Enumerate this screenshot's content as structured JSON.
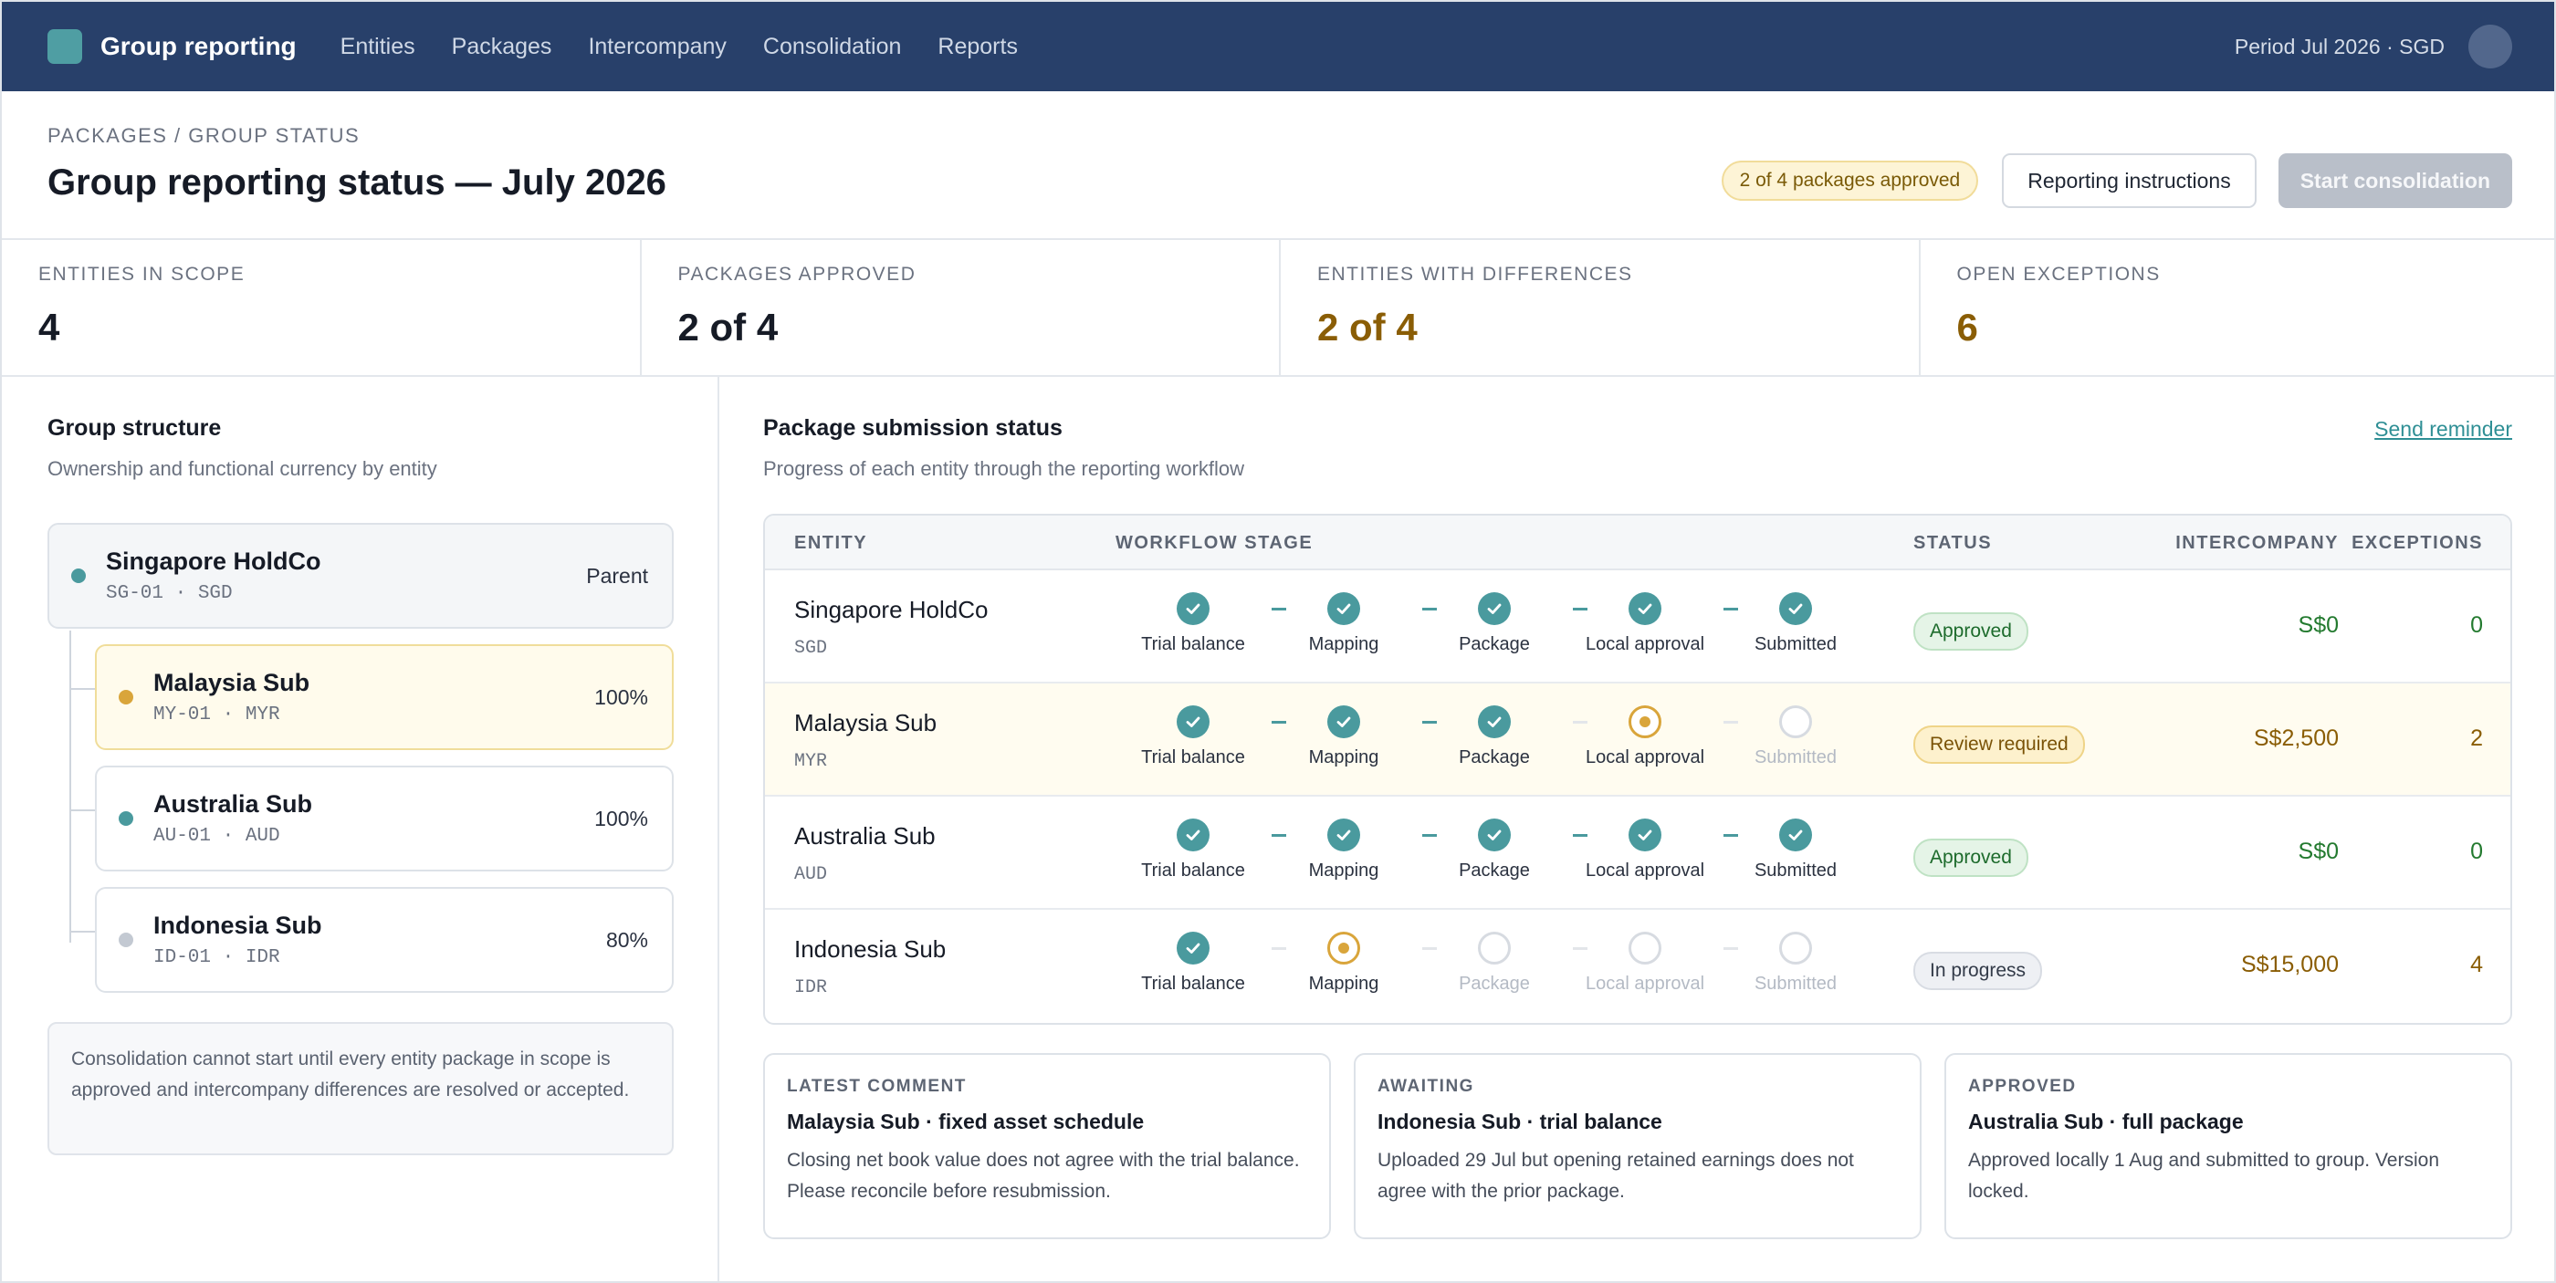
{
  "nav": {
    "brand": "Group reporting",
    "items": [
      "Entities",
      "Packages",
      "Intercompany",
      "Consolidation",
      "Reports"
    ],
    "period": "Period Jul 2026 · SGD"
  },
  "header": {
    "breadcrumb": "PACKAGES / GROUP STATUS",
    "title": "Group reporting status — July 2026",
    "approved_pill": "2 of 4 packages approved",
    "instructions_label": "Reporting instructions",
    "start_label": "Start consolidation"
  },
  "kpis": [
    {
      "label": "ENTITIES IN SCOPE",
      "value": "4"
    },
    {
      "label": "PACKAGES APPROVED",
      "value": "2 of 4"
    },
    {
      "label": "ENTITIES WITH DIFFERENCES",
      "value": "2 of 4"
    },
    {
      "label": "OPEN EXCEPTIONS",
      "value": "6"
    }
  ],
  "structure": {
    "title": "Group structure",
    "subtitle": "Ownership and functional currency by entity",
    "entities": [
      {
        "name": "Singapore HoldCo",
        "code": "SG-01 · SGD",
        "right": "Parent",
        "dot": "#4a9a9e"
      },
      {
        "name": "Malaysia Sub",
        "code": "MY-01 · MYR",
        "right": "100%",
        "dot": "#d9a53b"
      },
      {
        "name": "Australia Sub",
        "code": "AU-01 · AUD",
        "right": "100%",
        "dot": "#4a9a9e"
      },
      {
        "name": "Indonesia Sub",
        "code": "ID-01 · IDR",
        "right": "80%",
        "dot": "#c3c9d2"
      }
    ],
    "note": "Consolidation cannot start until every entity package in scope is approved and intercompany differences are resolved or accepted."
  },
  "submissions": {
    "title": "Package submission status",
    "subtitle": "Progress of each entity through the reporting workflow",
    "reminder": "Send reminder",
    "columns": [
      "ENTITY",
      "WORKFLOW STAGE",
      "STATUS",
      "INTERCOMPANY",
      "EXCEPTIONS"
    ],
    "stage_names": [
      "Trial balance",
      "Mapping",
      "Package",
      "Local approval",
      "Submitted"
    ],
    "rows": [
      {
        "name": "Singapore HoldCo",
        "currency": "SGD",
        "stages": [
          "done",
          "done",
          "done",
          "done",
          "done"
        ],
        "status": "Approved",
        "status_kind": "approved",
        "intercompany": "S$0",
        "exceptions": "0",
        "tone": "ok"
      },
      {
        "name": "Malaysia Sub",
        "currency": "MYR",
        "stages": [
          "done",
          "done",
          "done",
          "current",
          "pending"
        ],
        "status": "Review required",
        "status_kind": "review",
        "intercompany": "S$2,500",
        "exceptions": "2",
        "tone": "warn"
      },
      {
        "name": "Australia Sub",
        "currency": "AUD",
        "stages": [
          "done",
          "done",
          "done",
          "done",
          "done"
        ],
        "status": "Approved",
        "status_kind": "approved",
        "intercompany": "S$0",
        "exceptions": "0",
        "tone": "ok"
      },
      {
        "name": "Indonesia Sub",
        "currency": "IDR",
        "stages": [
          "done",
          "current",
          "pending",
          "pending",
          "pending"
        ],
        "status": "In progress",
        "status_kind": "progress",
        "intercompany": "S$15,000",
        "exceptions": "4",
        "tone": "warn"
      }
    ]
  },
  "cards": [
    {
      "label": "LATEST COMMENT",
      "title": "Malaysia Sub · fixed asset schedule",
      "body": "Closing net book value does not agree with the trial balance. Please reconcile before resubmission."
    },
    {
      "label": "AWAITING",
      "title": "Indonesia Sub · trial balance",
      "body": "Uploaded 29 Jul but opening retained earnings does not agree with the prior package."
    },
    {
      "label": "APPROVED",
      "title": "Australia Sub · full package",
      "body": "Approved locally 1 Aug and submitted to group. Version locked."
    }
  ]
}
